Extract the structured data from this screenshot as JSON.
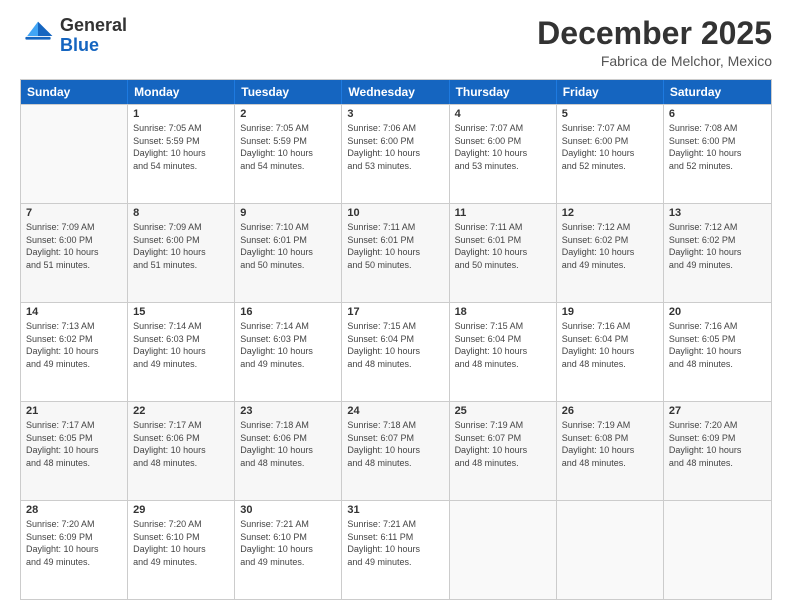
{
  "logo": {
    "general": "General",
    "blue": "Blue"
  },
  "header": {
    "month": "December 2025",
    "location": "Fabrica de Melchor, Mexico"
  },
  "weekdays": [
    "Sunday",
    "Monday",
    "Tuesday",
    "Wednesday",
    "Thursday",
    "Friday",
    "Saturday"
  ],
  "weeks": [
    [
      {
        "day": "",
        "info": ""
      },
      {
        "day": "1",
        "info": "Sunrise: 7:05 AM\nSunset: 5:59 PM\nDaylight: 10 hours\nand 54 minutes."
      },
      {
        "day": "2",
        "info": "Sunrise: 7:05 AM\nSunset: 5:59 PM\nDaylight: 10 hours\nand 54 minutes."
      },
      {
        "day": "3",
        "info": "Sunrise: 7:06 AM\nSunset: 6:00 PM\nDaylight: 10 hours\nand 53 minutes."
      },
      {
        "day": "4",
        "info": "Sunrise: 7:07 AM\nSunset: 6:00 PM\nDaylight: 10 hours\nand 53 minutes."
      },
      {
        "day": "5",
        "info": "Sunrise: 7:07 AM\nSunset: 6:00 PM\nDaylight: 10 hours\nand 52 minutes."
      },
      {
        "day": "6",
        "info": "Sunrise: 7:08 AM\nSunset: 6:00 PM\nDaylight: 10 hours\nand 52 minutes."
      }
    ],
    [
      {
        "day": "7",
        "info": "Sunrise: 7:09 AM\nSunset: 6:00 PM\nDaylight: 10 hours\nand 51 minutes."
      },
      {
        "day": "8",
        "info": "Sunrise: 7:09 AM\nSunset: 6:00 PM\nDaylight: 10 hours\nand 51 minutes."
      },
      {
        "day": "9",
        "info": "Sunrise: 7:10 AM\nSunset: 6:01 PM\nDaylight: 10 hours\nand 50 minutes."
      },
      {
        "day": "10",
        "info": "Sunrise: 7:11 AM\nSunset: 6:01 PM\nDaylight: 10 hours\nand 50 minutes."
      },
      {
        "day": "11",
        "info": "Sunrise: 7:11 AM\nSunset: 6:01 PM\nDaylight: 10 hours\nand 50 minutes."
      },
      {
        "day": "12",
        "info": "Sunrise: 7:12 AM\nSunset: 6:02 PM\nDaylight: 10 hours\nand 49 minutes."
      },
      {
        "day": "13",
        "info": "Sunrise: 7:12 AM\nSunset: 6:02 PM\nDaylight: 10 hours\nand 49 minutes."
      }
    ],
    [
      {
        "day": "14",
        "info": "Sunrise: 7:13 AM\nSunset: 6:02 PM\nDaylight: 10 hours\nand 49 minutes."
      },
      {
        "day": "15",
        "info": "Sunrise: 7:14 AM\nSunset: 6:03 PM\nDaylight: 10 hours\nand 49 minutes."
      },
      {
        "day": "16",
        "info": "Sunrise: 7:14 AM\nSunset: 6:03 PM\nDaylight: 10 hours\nand 49 minutes."
      },
      {
        "day": "17",
        "info": "Sunrise: 7:15 AM\nSunset: 6:04 PM\nDaylight: 10 hours\nand 48 minutes."
      },
      {
        "day": "18",
        "info": "Sunrise: 7:15 AM\nSunset: 6:04 PM\nDaylight: 10 hours\nand 48 minutes."
      },
      {
        "day": "19",
        "info": "Sunrise: 7:16 AM\nSunset: 6:04 PM\nDaylight: 10 hours\nand 48 minutes."
      },
      {
        "day": "20",
        "info": "Sunrise: 7:16 AM\nSunset: 6:05 PM\nDaylight: 10 hours\nand 48 minutes."
      }
    ],
    [
      {
        "day": "21",
        "info": "Sunrise: 7:17 AM\nSunset: 6:05 PM\nDaylight: 10 hours\nand 48 minutes."
      },
      {
        "day": "22",
        "info": "Sunrise: 7:17 AM\nSunset: 6:06 PM\nDaylight: 10 hours\nand 48 minutes."
      },
      {
        "day": "23",
        "info": "Sunrise: 7:18 AM\nSunset: 6:06 PM\nDaylight: 10 hours\nand 48 minutes."
      },
      {
        "day": "24",
        "info": "Sunrise: 7:18 AM\nSunset: 6:07 PM\nDaylight: 10 hours\nand 48 minutes."
      },
      {
        "day": "25",
        "info": "Sunrise: 7:19 AM\nSunset: 6:07 PM\nDaylight: 10 hours\nand 48 minutes."
      },
      {
        "day": "26",
        "info": "Sunrise: 7:19 AM\nSunset: 6:08 PM\nDaylight: 10 hours\nand 48 minutes."
      },
      {
        "day": "27",
        "info": "Sunrise: 7:20 AM\nSunset: 6:09 PM\nDaylight: 10 hours\nand 48 minutes."
      }
    ],
    [
      {
        "day": "28",
        "info": "Sunrise: 7:20 AM\nSunset: 6:09 PM\nDaylight: 10 hours\nand 49 minutes."
      },
      {
        "day": "29",
        "info": "Sunrise: 7:20 AM\nSunset: 6:10 PM\nDaylight: 10 hours\nand 49 minutes."
      },
      {
        "day": "30",
        "info": "Sunrise: 7:21 AM\nSunset: 6:10 PM\nDaylight: 10 hours\nand 49 minutes."
      },
      {
        "day": "31",
        "info": "Sunrise: 7:21 AM\nSunset: 6:11 PM\nDaylight: 10 hours\nand 49 minutes."
      },
      {
        "day": "",
        "info": ""
      },
      {
        "day": "",
        "info": ""
      },
      {
        "day": "",
        "info": ""
      }
    ]
  ]
}
